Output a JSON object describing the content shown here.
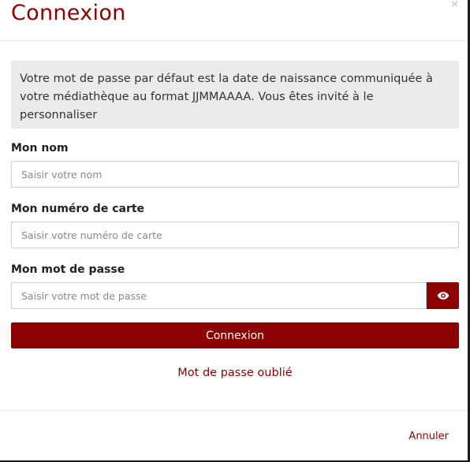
{
  "dialog": {
    "title": "Connexion",
    "close_glyph": "×"
  },
  "notice": {
    "text": "Votre mot de passe par défaut est la date de naissance communiquée à votre médiathèque au format JJMMAAAA. Vous êtes invité à le personnaliser"
  },
  "fields": {
    "name": {
      "label": "Mon nom",
      "placeholder": "Saisir votre nom",
      "value": ""
    },
    "card": {
      "label": "Mon numéro de carte",
      "placeholder": "Saisir votre numéro de carte",
      "value": ""
    },
    "password": {
      "label": "Mon mot de passe",
      "placeholder": "Saisir votre mot de passe",
      "value": "",
      "toggle_icon": "eye-icon"
    }
  },
  "actions": {
    "submit_label": "Connexion",
    "forgot_label": "Mot de passe oublié",
    "cancel_label": "Annuler"
  },
  "colors": {
    "accent": "#8b0000",
    "notice_bg": "#ebebeb",
    "border": "#cccccc"
  }
}
